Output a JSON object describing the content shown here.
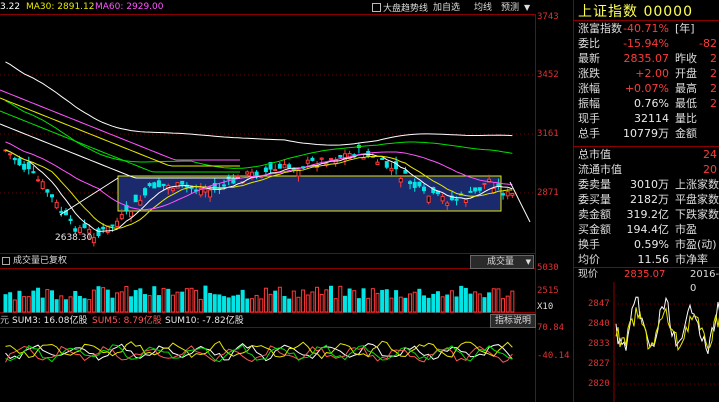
{
  "header": {
    "ma_readouts": [
      {
        "text": "3.22",
        "color": "#ffffff"
      },
      {
        "text": "MA30: 2891.12",
        "color": "#e8e800"
      },
      {
        "text": "MA60: 2929.00",
        "color": "#ff55ff"
      }
    ],
    "buttons": [
      "大盘趋势线",
      "加自选",
      "均线",
      "预测"
    ],
    "title": "上证指数 00000"
  },
  "price_axis": [
    "3743",
    "3452",
    "3161",
    "2871"
  ],
  "low_label": "2638.30",
  "volume_panel": {
    "title": "成交量已复权",
    "dropdown": "成交量",
    "axis": [
      "5030",
      "2515",
      "X10"
    ]
  },
  "indicator_panel": {
    "readouts": [
      {
        "text": "元",
        "color": "#c8c8c8"
      },
      {
        "text": "SUM3: 16.08亿股",
        "color": "#e8e8e8"
      },
      {
        "text": "SUM5: 8.79亿股",
        "color": "#ff5555"
      },
      {
        "text": "SUM10: -7.82亿股",
        "color": "#e8e8e8"
      }
    ],
    "button": "指标说明",
    "axis": [
      "70.84",
      "-40.14"
    ]
  },
  "quote": {
    "rows": [
      {
        "l1": "涨富指数",
        "v1": "-40.71%",
        "l2": "[年]",
        "v2": ""
      },
      {
        "l1": "委比",
        "v1": "-15.94%",
        "l2": "",
        "v2": "-82"
      },
      {
        "l1": "最新",
        "v1": "2835.07",
        "l2": "昨收",
        "v2": "2"
      },
      {
        "l1": "涨跌",
        "v1": "+2.00",
        "l2": "开盘",
        "v2": "2"
      },
      {
        "l1": "涨幅",
        "v1": "+0.07%",
        "l2": "最高",
        "v2": "2"
      },
      {
        "l1": "振幅",
        "v1": "0.76%",
        "l2": "最低",
        "v2": "2"
      },
      {
        "l1": "现手",
        "v1": "32114",
        "l2": "量比",
        "v2": ""
      },
      {
        "l1": "总手",
        "v1": "10779万",
        "l2": "金额",
        "v2": ""
      }
    ],
    "rows2": [
      {
        "l1": "总市值",
        "v1": "",
        "l2": "",
        "v2": "24"
      },
      {
        "l1": "流通市值",
        "v1": "",
        "l2": "",
        "v2": "20"
      },
      {
        "l1": "委卖量",
        "v1": "3010万",
        "l2": "上涨家数",
        "v2": ""
      },
      {
        "l1": "委买量",
        "v1": "2182万",
        "l2": "平盘家数",
        "v2": ""
      },
      {
        "l1": "卖金额",
        "v1": "319.2亿",
        "l2": "下跌家数",
        "v2": ""
      },
      {
        "l1": "买金额",
        "v1": "194.4亿",
        "l2": "市盈",
        "v2": ""
      },
      {
        "l1": "换手",
        "v1": "0.59%",
        "l2": "市盈(动)",
        "v2": ""
      },
      {
        "l1": "均价",
        "v1": "11.56",
        "l2": "市净率",
        "v2": ""
      }
    ],
    "current": {
      "label": "现价",
      "value": "2835.07",
      "date": "2016-0"
    },
    "mini_axis": [
      "2847",
      "2840",
      "2833",
      "2827",
      "2820"
    ]
  },
  "colors": {
    "up": "#ff3a3a",
    "down": "#00e5e5",
    "ma5": "#ffffff",
    "ma10": "#e8e800",
    "ma20": "#ff55ff",
    "ma60": "#00e000",
    "box": "#1a2a6c"
  }
}
